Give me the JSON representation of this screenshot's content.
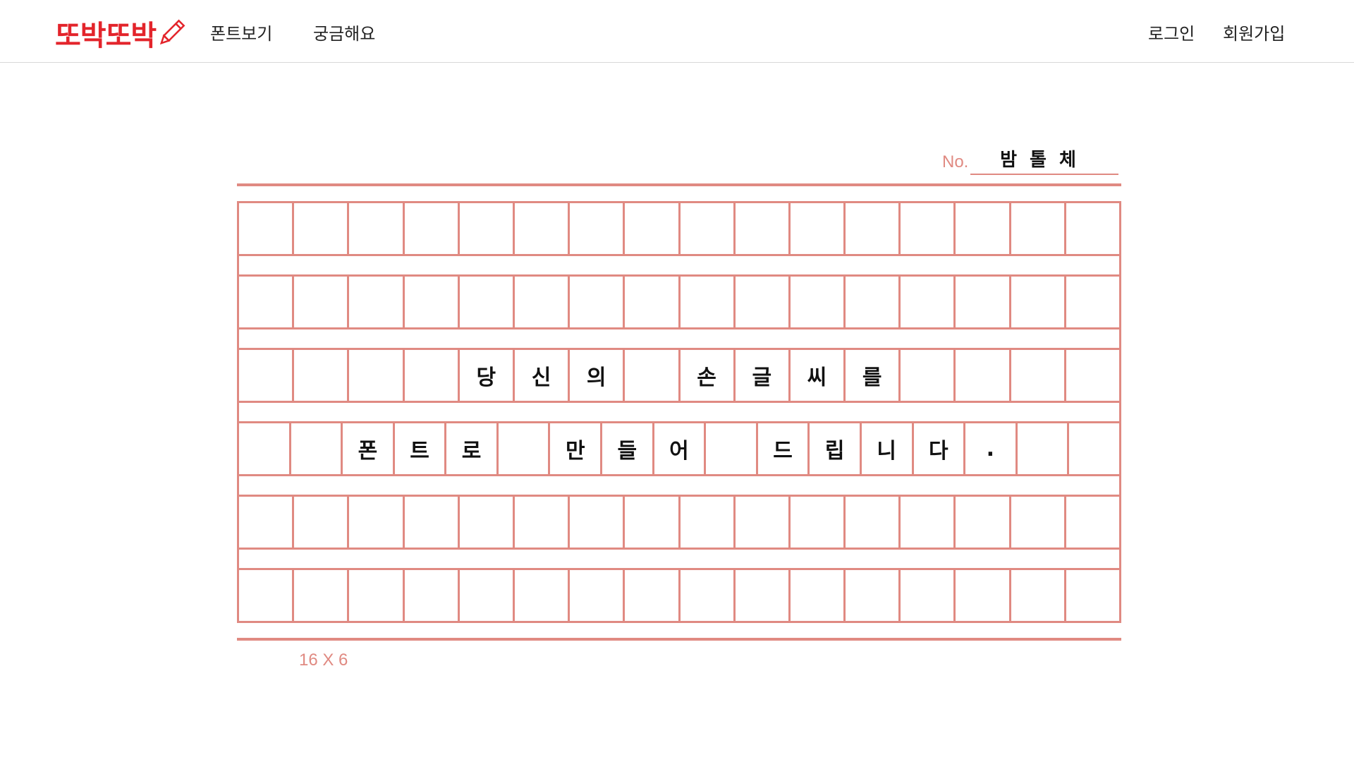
{
  "nav": {
    "logo": "또박또박",
    "links": [
      "폰트보기",
      "궁금해요"
    ],
    "auth": {
      "login": "로그인",
      "signup": "회원가입"
    }
  },
  "paper": {
    "title_label": "No.",
    "title_value": "밤톨체",
    "grid_size_label": "16 X 6",
    "rows": [
      [
        "",
        "",
        "",
        "",
        "",
        "",
        "",
        "",
        "",
        "",
        "",
        "",
        "",
        "",
        "",
        ""
      ],
      [
        "",
        "",
        "",
        "",
        "",
        "",
        "",
        "",
        "",
        "",
        "",
        "",
        "",
        "",
        "",
        ""
      ],
      [
        "",
        "",
        "",
        "",
        "당",
        "신",
        "의",
        "",
        "손",
        "글",
        "씨",
        "를",
        "",
        "",
        "",
        ""
      ],
      [
        "",
        "",
        "폰",
        "트",
        "로",
        "",
        "만",
        "들",
        "어",
        "",
        "드",
        "립",
        "니",
        "다",
        ".",
        "",
        ""
      ],
      [
        "",
        "",
        "",
        "",
        "",
        "",
        "",
        "",
        "",
        "",
        "",
        "",
        "",
        "",
        "",
        ""
      ],
      [
        "",
        "",
        "",
        "",
        "",
        "",
        "",
        "",
        "",
        "",
        "",
        "",
        "",
        "",
        "",
        ""
      ]
    ]
  },
  "colors": {
    "brand": "#e3242b",
    "grid_line": "#e08a82"
  }
}
